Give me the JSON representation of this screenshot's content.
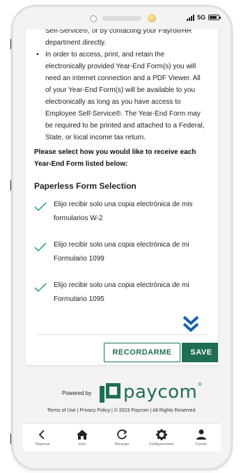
{
  "status_bar": {
    "network": "5G"
  },
  "content": {
    "cutoff_line": "Self-Service®, or by contacting your Payroll/HR",
    "cutoff_line_2": "department directly.",
    "bullet_text_1": "In order to access, print, and retain the",
    "bullet_text_2": "electronically provided Year-End Form(s) you will",
    "bullet_text_3": "need an internet connection and a PDF Viewer. All",
    "bullet_text_4": "of your Year-End Form(s) will be available to you",
    "bullet_text_5": "electronically as long as you have access to",
    "bullet_text_6": "Employee Self-Service®. The Year-End Form may",
    "bullet_text_7": "be required to be printed and attached to a Federal,",
    "bullet_text_8": "State, or local income tax return.",
    "instruction_1": "Please select how you would like to receive each",
    "instruction_2": "Year-End Form listed below:",
    "section_title": "Paperless Form Selection",
    "options": [
      {
        "line1": "Elijo recibir solo una copia electrónica de mis",
        "line2": "formularios W-2"
      },
      {
        "line1": "Elijo recibir solo una copia electrónica de mi",
        "line2": "Formulario 1099"
      },
      {
        "line1": "Elijo recibir solo una copia electrónica de mi",
        "line2": "Formulario 1095"
      }
    ]
  },
  "buttons": {
    "recordarme": "RECORDARME",
    "save": "SAVE"
  },
  "branding": {
    "powered_by": "Powered by",
    "logo": "paycom",
    "tm": "®"
  },
  "footer": {
    "links": "Terms of Use | Privacy Policy | © 2023 Paycom | All Rights Reserved."
  },
  "nav": [
    {
      "label": "Regresar"
    },
    {
      "label": "Inicio"
    },
    {
      "label": "Recargar"
    },
    {
      "label": "Configuraciones"
    },
    {
      "label": "Cuenta"
    }
  ],
  "colors": {
    "brand": "#1f6e52",
    "check": "#3aa39a",
    "chevron": "#1b5fb0"
  }
}
